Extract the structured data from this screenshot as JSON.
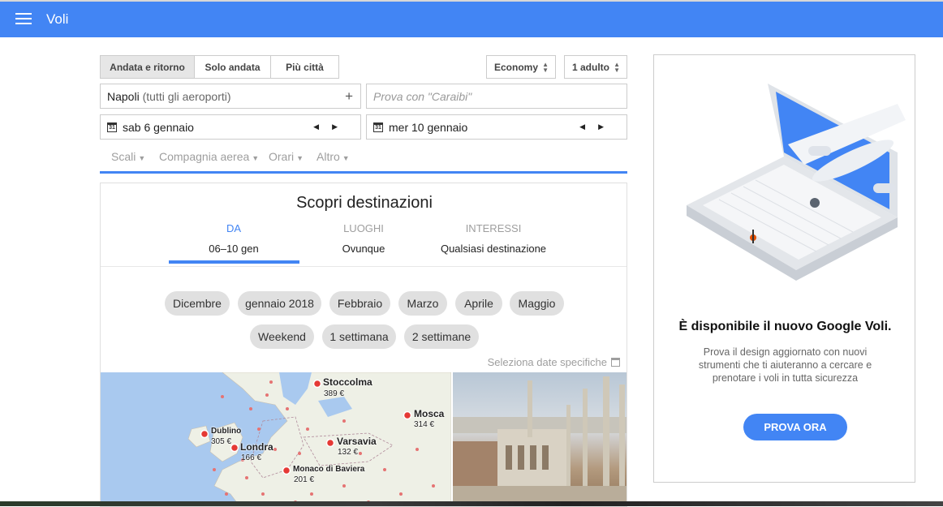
{
  "app": {
    "title": "Voli"
  },
  "trip_type": [
    {
      "label": "Andata e ritorno",
      "active": true
    },
    {
      "label": "Solo andata",
      "active": false
    },
    {
      "label": "Più città",
      "active": false
    }
  ],
  "cabin": {
    "value": "Economy"
  },
  "passengers": {
    "value": "1 adulto"
  },
  "origin": {
    "city": "Napoli",
    "detail": "(tutti gli aeroporti)",
    "add_icon": "plus-icon"
  },
  "destination": {
    "placeholder": "Prova con \"Caraibi\""
  },
  "dates": {
    "depart": {
      "icon_text": "31",
      "value": "sab 6 gennaio"
    },
    "return": {
      "icon_text": "31",
      "value": "mer 10 gennaio"
    }
  },
  "filters": [
    "Scali",
    "Compagnia aerea",
    "Orari",
    "Altro"
  ],
  "discover": {
    "title": "Scopri destinazioni",
    "tabs": [
      {
        "label": "DA",
        "value": "06–10 gen",
        "active": true
      },
      {
        "label": "LUOGHI",
        "value": "Ovunque",
        "active": false
      },
      {
        "label": "INTERESSI",
        "value": "Qualsiasi destinazione",
        "active": false
      }
    ],
    "months": [
      "Dicembre",
      "gennaio 2018",
      "Febbraio",
      "Marzo",
      "Aprile",
      "Maggio"
    ],
    "durations": [
      "Weekend",
      "1 settimana",
      "2 settimane"
    ],
    "select_dates": "Seleziona date specifiche"
  },
  "map_cities": [
    {
      "name": "Stoccolma",
      "price": "389 €"
    },
    {
      "name": "Mosca",
      "price": "314 €"
    },
    {
      "name": "Dublino",
      "price": "305 €"
    },
    {
      "name": "Londra",
      "price": "166 €"
    },
    {
      "name": "Varsavia",
      "price": "132 €"
    },
    {
      "name": "Monaco di Baviera",
      "price": "201 €"
    }
  ],
  "promo": {
    "title": "È disponibile il nuovo Google Voli.",
    "body": "Prova il design aggiornato con nuovi strumenti che ti aiuteranno a cercare e prenotare i voli in tutta sicurezza",
    "button": "PROVA ORA"
  },
  "colors": {
    "brand_blue": "#4285f4",
    "chip_gray": "#e0e0e0",
    "map_water": "#a9c9ef"
  }
}
